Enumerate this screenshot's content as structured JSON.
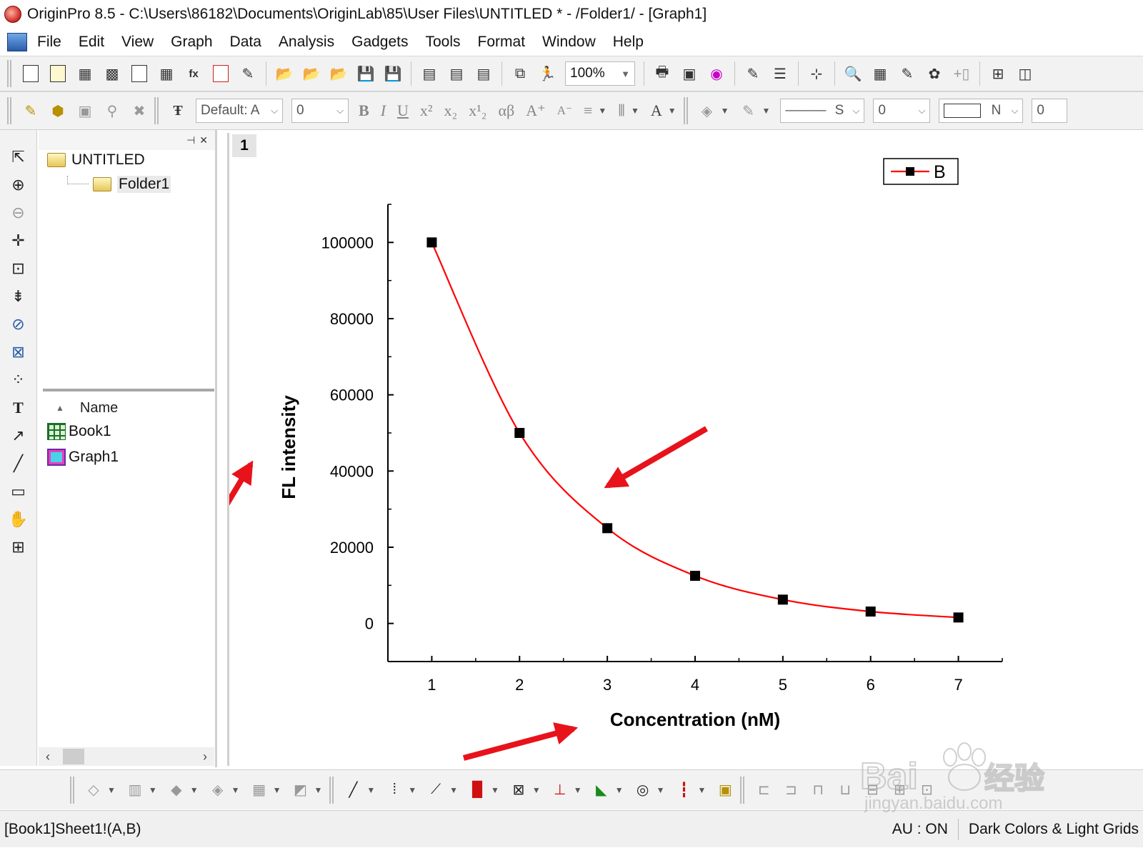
{
  "window": {
    "title": "OriginPro 8.5 - C:\\Users\\86182\\Documents\\OriginLab\\85\\User Files\\UNTITLED * - /Folder1/ - [Graph1]"
  },
  "menu": [
    "File",
    "Edit",
    "View",
    "Graph",
    "Data",
    "Analysis",
    "Gadgets",
    "Tools",
    "Format",
    "Window",
    "Help"
  ],
  "toolbar": {
    "zoom": "100%",
    "font_name": "Default: A",
    "font_size": "0",
    "line_style": "S",
    "line_width": "0",
    "fill_pattern": "N",
    "fill_value": "0"
  },
  "project_explorer": {
    "tree": {
      "root": "UNTITLED",
      "folder": "Folder1"
    },
    "list_header": "Name",
    "items": [
      {
        "name": "Book1",
        "icon": "workbook-icon"
      },
      {
        "name": "Graph1",
        "icon": "graph-icon"
      }
    ]
  },
  "graph": {
    "layer_label": "1",
    "legend_label": "B"
  },
  "chart_data": {
    "type": "line",
    "x": [
      1,
      2,
      3,
      4,
      5,
      6,
      7
    ],
    "series": [
      {
        "name": "B",
        "values": [
          100000,
          50000,
          25000,
          12500,
          6250,
          3125,
          1562.5
        ],
        "color": "#ff0000",
        "marker": "square"
      }
    ],
    "xlabel": "Concentration (nM)",
    "ylabel": "FL intensity",
    "xlim": [
      0.5,
      7.5
    ],
    "ylim": [
      -10000,
      110000
    ],
    "x_ticks": [
      1,
      2,
      3,
      4,
      5,
      6,
      7
    ],
    "y_ticks": [
      0,
      20000,
      40000,
      60000,
      80000,
      100000
    ],
    "legend": "top-right",
    "grid": false,
    "annotations": [
      "red arrow pointing to y-axis label",
      "red arrow pointing to curve",
      "red arrow pointing to x-axis label"
    ]
  },
  "statusbar": {
    "left": "[Book1]Sheet1!(A,B)",
    "au": "AU : ON",
    "theme": "Dark Colors & Light Grids"
  },
  "watermark": {
    "brand": "Bai",
    "brand_cn": "经验",
    "url": "jingyan.baidu.com"
  },
  "colors": {
    "curve": "#ff0000",
    "marker": "#000000",
    "arrow": "#e8121b"
  }
}
